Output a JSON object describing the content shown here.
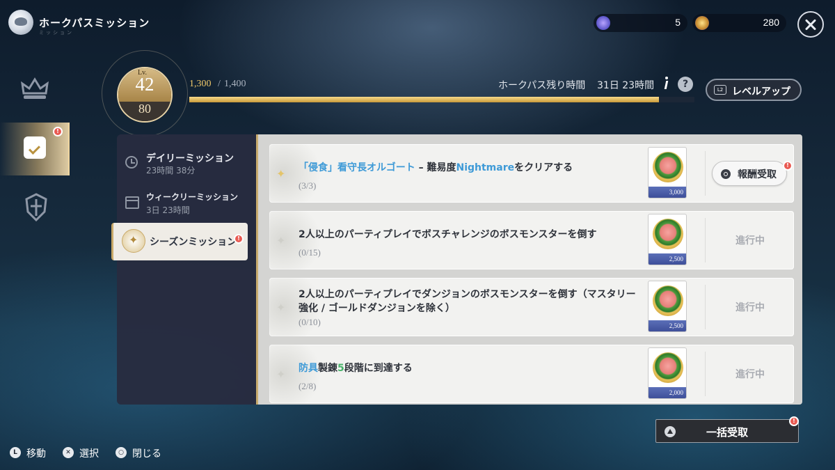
{
  "header": {
    "title": "ホークパスミッション",
    "subtitle": "ミッション",
    "currencies": [
      {
        "icon": "star-token-icon",
        "value": "5"
      },
      {
        "icon": "crystal-token-icon",
        "value": "280"
      }
    ]
  },
  "level": {
    "prefix": "Lv.",
    "current": "42",
    "max": "80",
    "xp_current": "1,300",
    "xp_slash": "/",
    "xp_target": "1,400",
    "xp_fraction": 0.93
  },
  "pass": {
    "remaining_label": "ホークパス残り時間",
    "remaining_value": "31日 23時間",
    "help": "?",
    "levelup_key": "L2",
    "levelup_label": "レベルアップ"
  },
  "tabs": [
    {
      "title": "デイリーミッション",
      "sub": "23時間 38分"
    },
    {
      "title": "ウィークリーミッション",
      "sub": "3日 23時間"
    },
    {
      "title": "シーズンミッション",
      "sub": ""
    }
  ],
  "missions": [
    {
      "segments": [
        {
          "text": "「侵食」看守長オルゴート",
          "style": "blue"
        },
        {
          "text": " – 難易度",
          "style": ""
        },
        {
          "text": "Nightmare",
          "style": "blue"
        },
        {
          "text": "をクリアする",
          "style": ""
        }
      ],
      "progress": "(3/3)",
      "reward": "3,000",
      "status": "報酬受取",
      "claimable": true
    },
    {
      "segments": [
        {
          "text": "2人以上のパーティプレイでボスチャレンジのボスモンスターを倒す",
          "style": ""
        }
      ],
      "progress": "(0/15)",
      "reward": "2,500",
      "status": "進行中",
      "claimable": false
    },
    {
      "segments": [
        {
          "text": "2人以上のパーティプレイでダンジョンのボスモンスターを倒す（マスタリー強化 / ゴールドダンジョンを除く）",
          "style": ""
        }
      ],
      "progress": "(0/10)",
      "reward": "2,500",
      "status": "進行中",
      "claimable": false
    },
    {
      "segments": [
        {
          "text": "防具",
          "style": "blue"
        },
        {
          "text": "製錬",
          "style": ""
        },
        {
          "text": "5",
          "style": "green"
        },
        {
          "text": "段階に到達する",
          "style": ""
        }
      ],
      "progress": "(2/8)",
      "reward": "2,000",
      "status": "進行中",
      "claimable": false
    }
  ],
  "bulk_claim": {
    "label": "一括受取"
  },
  "alert_mark": "!",
  "hints": [
    {
      "key": "L",
      "label": "移動"
    },
    {
      "key": "✕",
      "label": "選択"
    },
    {
      "key": "○",
      "label": "閉じる"
    }
  ],
  "colors": {
    "accent_gold": "#c99a3a",
    "highlight_blue": "#3e9ad7",
    "highlight_green": "#49b36b",
    "alert_red": "#e95a52"
  }
}
